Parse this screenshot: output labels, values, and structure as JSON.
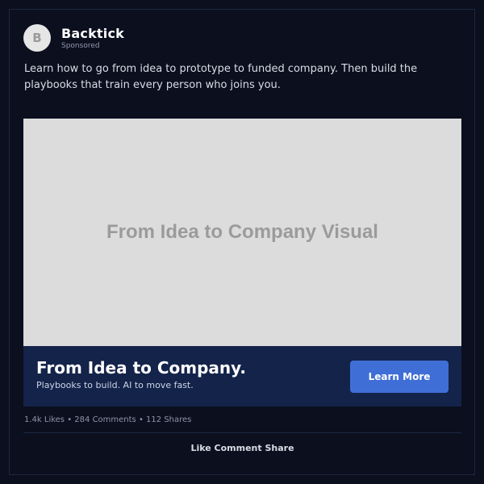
{
  "post": {
    "avatar_letter": "B",
    "brand_name": "Backtick",
    "sponsored_label": "Sponsored",
    "body_text": "Learn how to go from idea to prototype to funded company. Then build the playbooks that train every person who joins you.",
    "media_label": "From Idea to Company Visual",
    "cta": {
      "title": "From Idea to Company.",
      "subtitle": "Playbooks to build. AI to move fast.",
      "button_label": "Learn More"
    },
    "stats": {
      "likes": "1.4k Likes",
      "separator": " • ",
      "comments": "284 Comments",
      "shares": "112 Shares"
    },
    "actions": {
      "like": "Like",
      "comment": "Comment",
      "share": "Share"
    }
  },
  "colors": {
    "background": "#0b0f1e",
    "cta_bar": "#14234a",
    "button": "#3f6fd6",
    "media_placeholder": "#dcdcdc"
  }
}
